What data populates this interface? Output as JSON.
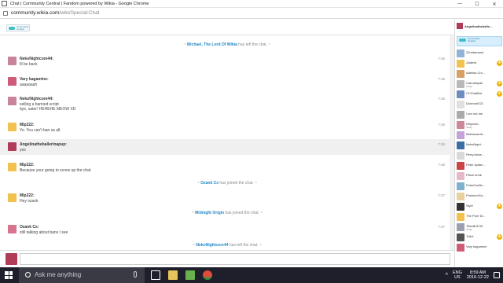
{
  "window": {
    "title": "Chat | Community Central | Fandom powered by Wikia - Google Chrome",
    "minimize": "—",
    "maximize": "☐",
    "close": "✕"
  },
  "address": {
    "domain": "community.wikia.com",
    "path": "/wiki/Special:Chat"
  },
  "logo": {
    "text": "Community\nCentral"
  },
  "chat": {
    "events": [
      {
        "who": "Michael, The Lord Of Wikia",
        "text": "has left the chat."
      },
      {
        "who": "Ozank Cx",
        "text": "has joined the chat."
      },
      {
        "who": "Midnight Origin",
        "text": "has joined the chat."
      },
      {
        "who": "NekoNightcore44",
        "text": "has left the chat."
      }
    ],
    "messages": [
      {
        "user": "NekoNightcore44:",
        "lines": [
          "Ill be back"
        ],
        "time": "7:45"
      },
      {
        "user": "Vary kagamine:",
        "lines": [
          "aaaaaaah"
        ],
        "time": "7:45"
      },
      {
        "user": "NekoNightcore44:",
        "lines": [
          "selling a banned script",
          "bye, sater! HEHEHE MEOW XD"
        ],
        "time": "7:45"
      },
      {
        "user": "Mlp222:",
        "lines": [
          "Yo. You can't ban us all."
        ],
        "time": "7:46"
      },
      {
        "user": "Angelinatheballerinapup:",
        "lines": [
          "yes"
        ],
        "time": "7:46"
      },
      {
        "user": "Mlp222:",
        "lines": [
          "Because your going to screw up the chat"
        ],
        "time": "7:46"
      },
      {
        "user": "Mlp222:",
        "lines": [
          "Hey ozank"
        ],
        "time": "7:47"
      },
      {
        "user": "Ozank Cx:",
        "lines": [
          "still talking about bans I see"
        ],
        "time": "7:47"
      }
    ]
  },
  "userlist": {
    "me": "Angelinatheballe...",
    "wiki": "Community\nCentral",
    "users": [
      {
        "name": "22mdamand",
        "status": "",
        "star": false
      },
      {
        "name": "2Admix",
        "status": "",
        "star": true
      },
      {
        "name": "Adelina Cro...",
        "status": "",
        "star": false
      },
      {
        "name": "Caboblayah",
        "status": "Away",
        "star": true
      },
      {
        "name": "CCChatBot",
        "status": "",
        "star": true
      },
      {
        "name": "Dunmort221",
        "status": "",
        "star": false
      },
      {
        "name": "I am not me",
        "status": "",
        "star": false
      },
      {
        "name": "Kittyrobo",
        "status": "Away",
        "star": false
      },
      {
        "name": "Markusandr...",
        "status": "",
        "star": false
      },
      {
        "name": "NekoNight...",
        "status": "",
        "star": false
      },
      {
        "name": "PerryJacks...",
        "status": "",
        "star": false
      },
      {
        "name": "Peter spider...",
        "status": "",
        "star": false
      },
      {
        "name": "Place.erink",
        "status": "",
        "star": false
      },
      {
        "name": "PolarGorilln...",
        "status": "",
        "star": false
      },
      {
        "name": "PusheenGu...",
        "status": "",
        "star": false
      },
      {
        "name": "Slyel",
        "status": "",
        "star": true
      },
      {
        "name": "The Pure Di...",
        "status": "",
        "star": false
      },
      {
        "name": "Titanilin1HS",
        "status": "Away",
        "star": false
      },
      {
        "name": "Tullol",
        "status": "",
        "star": true
      },
      {
        "name": "Vary kagamine",
        "status": "",
        "star": false
      }
    ]
  },
  "taskbar": {
    "search_placeholder": "Ask me anything",
    "tray_chevron": "^",
    "lang": "ENG",
    "region": "US",
    "time": "8:59 AM",
    "date": "2016-12-22"
  }
}
